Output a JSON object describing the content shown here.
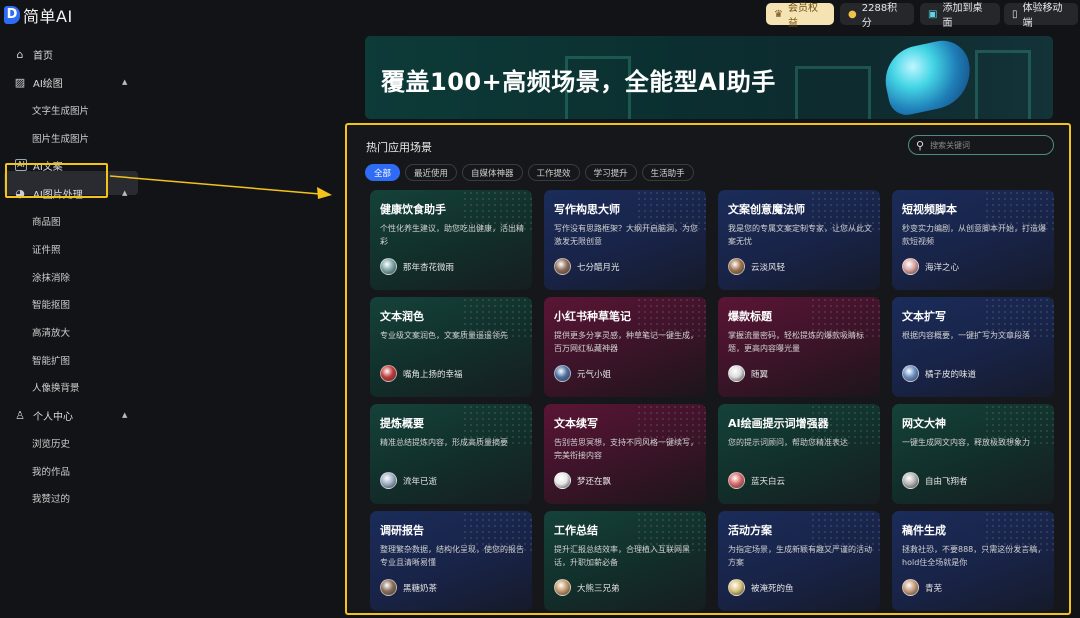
{
  "app": {
    "logo_mark": "D",
    "logo_text": "简单AI"
  },
  "header": {
    "member": "会员权益",
    "points": "2288积分",
    "desktop": "添加到桌面",
    "mobile": "体验移动端"
  },
  "sidebar": {
    "home": "首页",
    "ai_draw": {
      "label": "AI绘图",
      "items": [
        "文字生成图片",
        "图片生成图片"
      ]
    },
    "ai_copy": "AI文案",
    "ai_image": {
      "label": "AI图片处理",
      "items": [
        "商品图",
        "证件照",
        "涂抹消除",
        "智能抠图",
        "高清放大",
        "智能扩图",
        "人像换背景"
      ]
    },
    "personal": {
      "label": "个人中心",
      "items": [
        "浏览历史",
        "我的作品",
        "我赞过的"
      ]
    }
  },
  "banner": {
    "title": "覆盖100+高频场景，全能型AI助手"
  },
  "panel": {
    "title": "热门应用场景",
    "search_placeholder": "搜索关键词",
    "tabs": [
      "全部",
      "最近使用",
      "自媒体神器",
      "工作提效",
      "学习提升",
      "生活助手"
    ],
    "active_tab": "全部"
  },
  "cards": [
    {
      "title": "健康饮食助手",
      "desc": "个性化养生建议，助您吃出健康，活出精彩",
      "author": "那年杏花微雨",
      "theme": "green",
      "avatar_color": "#7fa7a8"
    },
    {
      "title": "写作构思大师",
      "desc": "写作没有思路框架？大纲开启脑洞，为您激发无限创意",
      "author": "七分醋月光",
      "theme": "blue",
      "avatar_color": "#8f6d5c"
    },
    {
      "title": "文案创意魔法师",
      "desc": "我是您的专属文案定制专家，让您从此文案无忧",
      "author": "云淡风轻",
      "theme": "blue",
      "avatar_color": "#a0744f"
    },
    {
      "title": "短视频脚本",
      "desc": "秒变实力编剧，从创意脚本开始，打造爆款短视频",
      "author": "海洋之心",
      "theme": "blue",
      "avatar_color": "#d9a3a3"
    },
    {
      "title": "文本润色",
      "desc": "专业级文案润色，文案质量遥遥领先",
      "author": "嘴角上扬的幸福",
      "theme": "green",
      "avatar_color": "#c23b3b"
    },
    {
      "title": "小红书种草笔记",
      "desc": "提供更多分享灵感，种草笔记一键生成，百万网红私藏神器",
      "author": "元气小姐",
      "theme": "red",
      "avatar_color": "#4d6fa3"
    },
    {
      "title": "爆款标题",
      "desc": "掌握流量密码，轻松提炼的爆款吸睛标题，更高内容曝光量",
      "author": "随翼",
      "theme": "red",
      "avatar_color": "#dcdcdc"
    },
    {
      "title": "文本扩写",
      "desc": "根据内容概要，一键扩写为文章段落",
      "author": "橘子皮的味道",
      "theme": "blue",
      "avatar_color": "#6b8fc4"
    },
    {
      "title": "提炼概要",
      "desc": "精准总结提炼内容，形成高质量摘要",
      "author": "流年已逝",
      "theme": "green",
      "avatar_color": "#9fb0c8"
    },
    {
      "title": "文本续写",
      "desc": "告别苦思冥想，支持不同风格一键续写，完美衔接内容",
      "author": "梦还在飘",
      "theme": "red",
      "avatar_color": "#e8e8e8"
    },
    {
      "title": "AI绘画提示词增强器",
      "desc": "您的提示词顾问，帮助您精准表达",
      "author": "蓝天白云",
      "theme": "green",
      "avatar_color": "#d96a6a"
    },
    {
      "title": "网文大神",
      "desc": "一键生成网文内容，释放极致想象力",
      "author": "自由飞翔者",
      "theme": "green",
      "avatar_color": "#b7b7b7"
    },
    {
      "title": "调研报告",
      "desc": "整理繁杂数据，结构化呈现，使您的报告专业且清晰易懂",
      "author": "黑糖奶茶",
      "theme": "blue",
      "avatar_color": "#8a6e5a"
    },
    {
      "title": "工作总结",
      "desc": "提升汇报总结效率，合理植入互联网黑话，升职加薪必备",
      "author": "大熊三兄弟",
      "theme": "green",
      "avatar_color": "#c49a6c"
    },
    {
      "title": "活动方案",
      "desc": "为指定场景，生成新颖有趣又严谨的活动方案",
      "author": "被淹死的鱼",
      "theme": "blue",
      "avatar_color": "#d9c27a"
    },
    {
      "title": "稿件生成",
      "desc": "拯救社恐，不要888，只需这份发言稿，hold住全场就是你",
      "author": "青芜",
      "theme": "blue",
      "avatar_color": "#c69b7b"
    }
  ],
  "colors": {
    "accent": "#2f6cf6",
    "highlight": "#f3c31b",
    "member_pill": "#f6e3b4"
  },
  "icons": [
    "home-icon",
    "image-icon",
    "ai-copy-icon",
    "palette-icon",
    "user-icon",
    "search-icon",
    "coin-icon",
    "vip-icon",
    "desktop-icon",
    "phone-icon"
  ]
}
